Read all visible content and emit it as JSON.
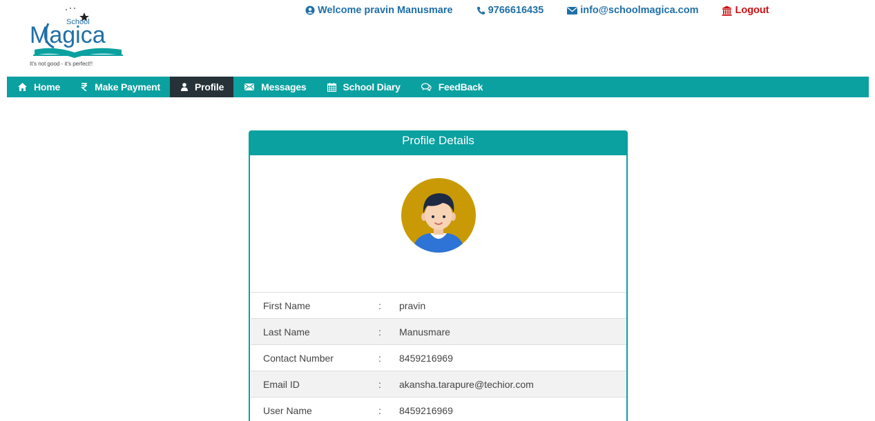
{
  "brand": {
    "logo_small": "School",
    "logo_main": "Magica",
    "tagline": "It's not good - it's perfect!!"
  },
  "topbar": {
    "welcome": "Welcome pravin Manusmare",
    "phone": "9766616435",
    "email": "info@schoolmagica.com",
    "logout": "Logout"
  },
  "nav": {
    "items": [
      {
        "label": "Home",
        "icon": "home-icon"
      },
      {
        "label": "Make Payment",
        "icon": "rupee-icon"
      },
      {
        "label": "Profile",
        "icon": "user-icon"
      },
      {
        "label": "Messages",
        "icon": "envelope-icon"
      },
      {
        "label": "School Diary",
        "icon": "calendar-icon"
      },
      {
        "label": "FeedBack",
        "icon": "comments-icon"
      }
    ],
    "active": "Profile"
  },
  "profile": {
    "title": "Profile Details",
    "rows": [
      {
        "label": "First Name",
        "sep": ":",
        "value": "pravin"
      },
      {
        "label": "Last Name",
        "sep": ":",
        "value": "Manusmare"
      },
      {
        "label": "Contact Number",
        "sep": ":",
        "value": "8459216969"
      },
      {
        "label": "Email ID",
        "sep": ":",
        "value": "akansha.tarapure@techior.com"
      },
      {
        "label": "User Name",
        "sep": ":",
        "value": "8459216969"
      }
    ]
  },
  "colors": {
    "accent": "#0aa1a0",
    "active_nav": "#263238",
    "link_blue": "#1f6fa8",
    "logout_red": "#cc1010"
  }
}
